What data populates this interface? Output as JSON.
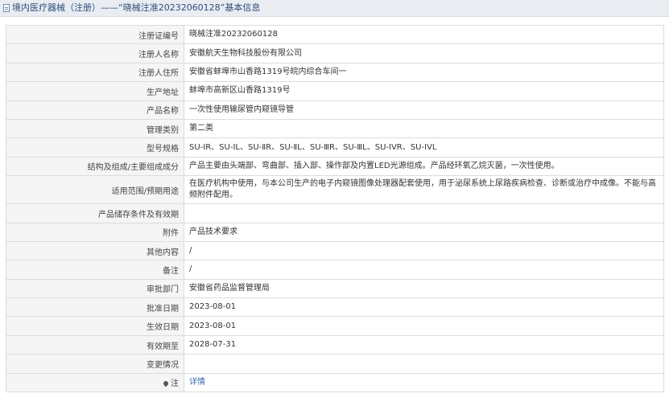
{
  "header": {
    "title": "境内医疗器械（注册）——“晓械注准20232060128”基本信息",
    "icon": "document-icon"
  },
  "rows": [
    {
      "label": "注册证编号",
      "value": "晓械注准20232060128"
    },
    {
      "label": "注册人名称",
      "value": "安徽航天生物科技股份有限公司"
    },
    {
      "label": "注册人住所",
      "value": "安徽省蚌埠市山香路1319号皖内综合车间一"
    },
    {
      "label": "生产地址",
      "value": "蚌埠市高新区山香路1319号"
    },
    {
      "label": "产品名称",
      "value": "一次性使用输尿管内窥镜导管"
    },
    {
      "label": "管理类别",
      "value": "第二类"
    },
    {
      "label": "型号规格",
      "value": "SU-ⅠR、SU-ⅠL、SU-ⅡR、SU-ⅡL、SU-ⅢR、SU-ⅢL、SU-IVR、SU-IVL"
    },
    {
      "label": "结构及组成/主要组成成分",
      "value": "产品主要由头端部、弯曲部、插入部、操作部及内置LED光源组成。产品经环氧乙烷灭菌，一次性使用。"
    },
    {
      "label": "适用范围/预期用途",
      "value": "在医疗机构中使用，与本公司生产的电子内窥镜图像处理器配套使用，用于泌尿系统上尿路疾病检查、诊断或治疗中成像。不能与高频附件配用。"
    },
    {
      "label": "产品储存条件及有效期",
      "value": ""
    },
    {
      "label": "附件",
      "value": "产品技术要求"
    },
    {
      "label": "其他内容",
      "value": "/"
    },
    {
      "label": "备注",
      "value": "/"
    },
    {
      "label": "审批部门",
      "value": "安徽省药品监督管理局"
    },
    {
      "label": "批准日期",
      "value": "2023-08-01"
    },
    {
      "label": "生效日期",
      "value": "2023-08-01"
    },
    {
      "label": "有效期至",
      "value": "2028-07-31"
    },
    {
      "label": "变更情况",
      "value": ""
    }
  ],
  "note_row": {
    "label": "注",
    "icon": "pin-icon",
    "link_text": "详情"
  },
  "colors": {
    "header_bg": "#e9edf2",
    "header_text": "#2e4d7b",
    "label_bg": "#f5f5f5",
    "border": "#dcdcdc",
    "link": "#3a66b0"
  }
}
